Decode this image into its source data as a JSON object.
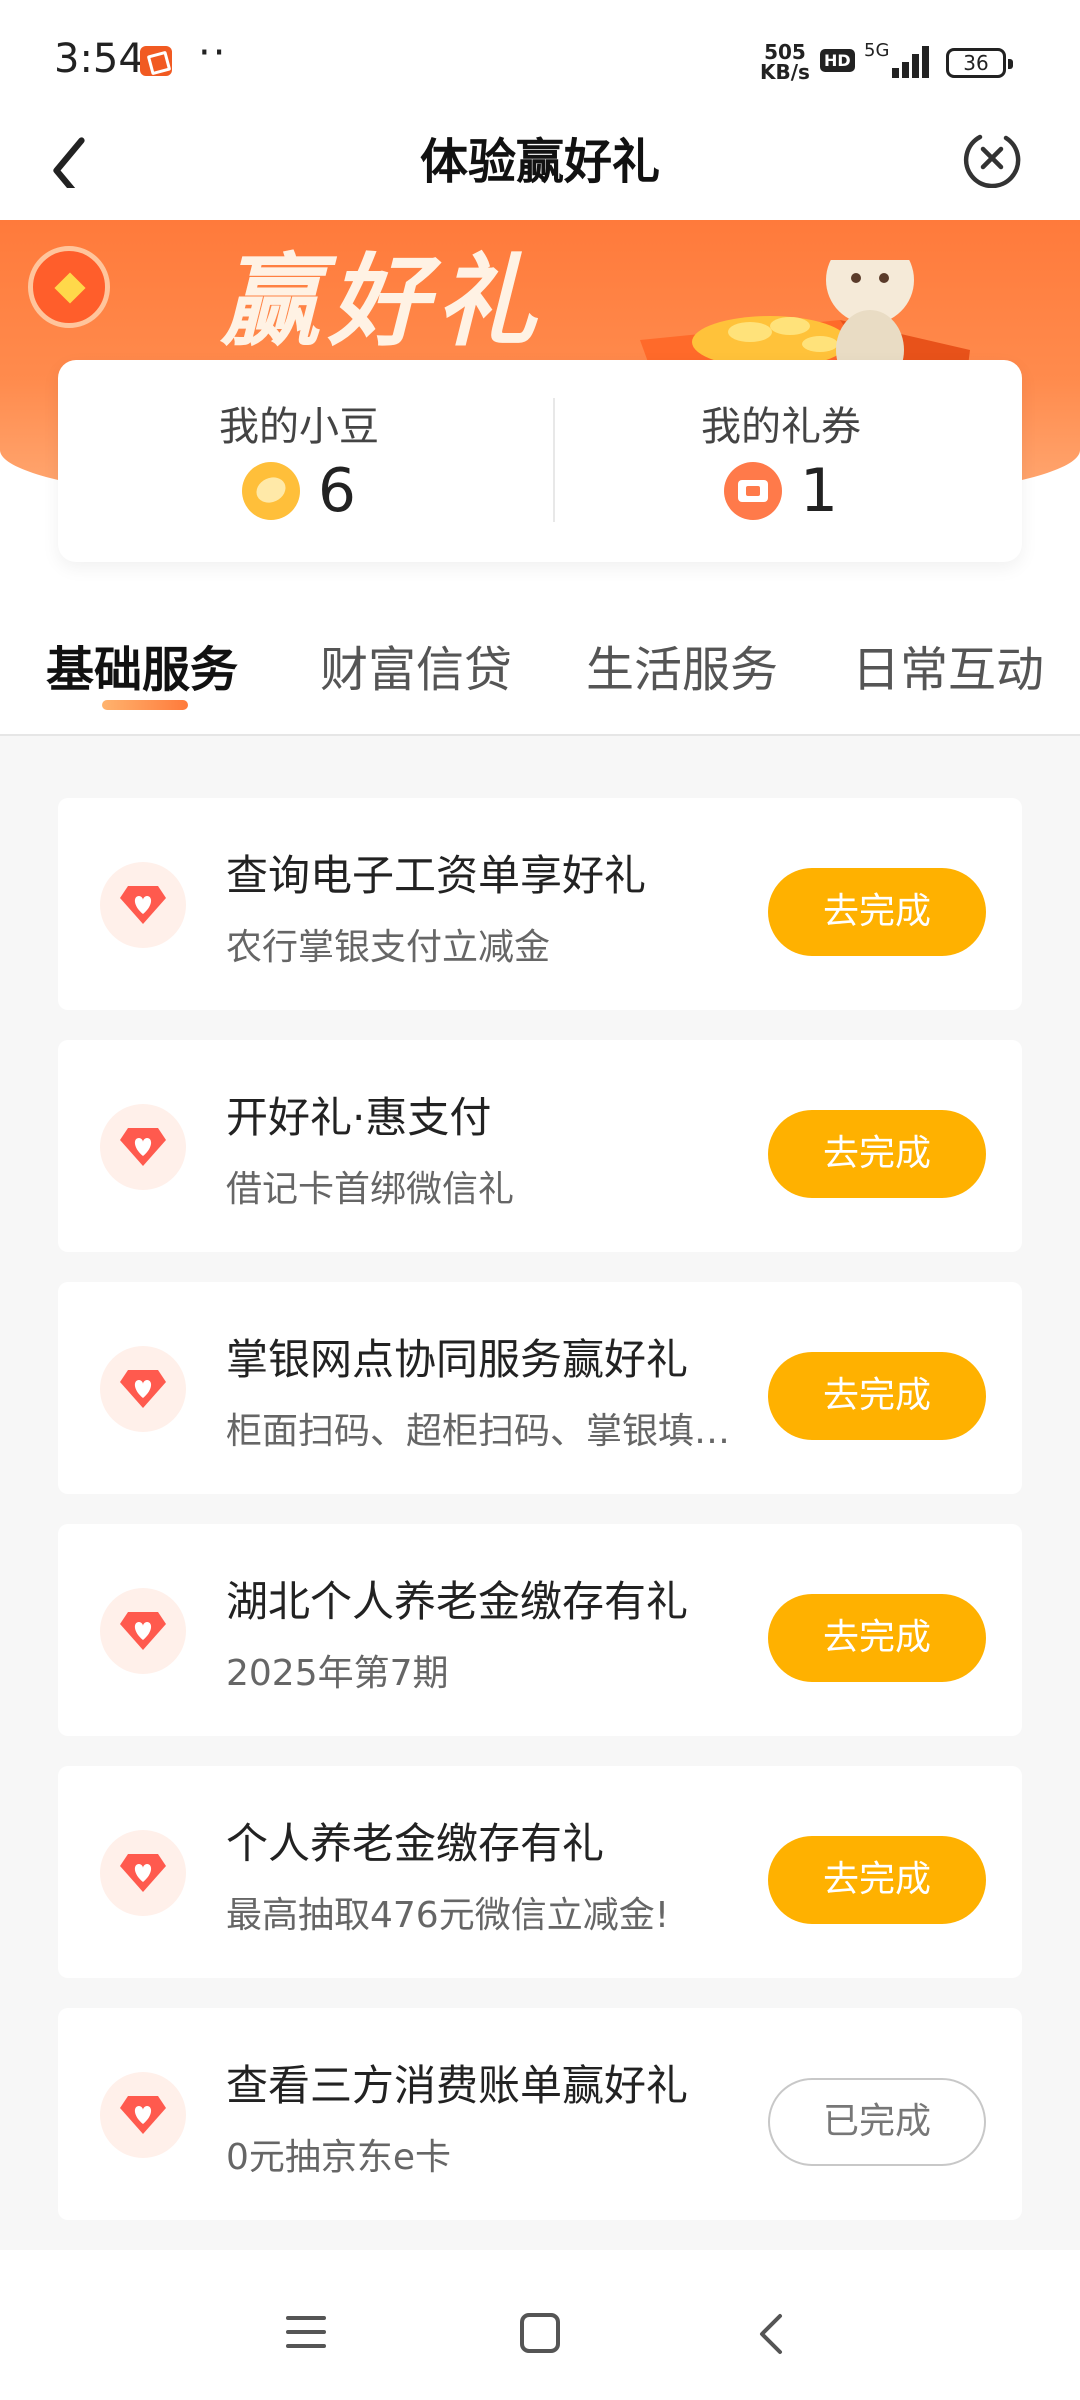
{
  "status_bar": {
    "time": "3:54",
    "dots": "··",
    "net_speed_value": "505",
    "net_speed_unit": "KB/s",
    "hd": "HD",
    "network": "5G",
    "battery": "36"
  },
  "nav": {
    "title": "体验赢好礼",
    "back_icon": "chevron-left-icon",
    "close_icon": "close-circle-icon"
  },
  "banner": {
    "title": "赢好礼"
  },
  "summary": {
    "beans_label": "我的小豆",
    "beans_value": "6",
    "coupons_label": "我的礼券",
    "coupons_value": "1"
  },
  "tabs": [
    {
      "label": "基础服务",
      "active": true
    },
    {
      "label": "财富信贷",
      "active": false
    },
    {
      "label": "生活服务",
      "active": false
    },
    {
      "label": "日常互动",
      "active": false
    }
  ],
  "tasks": [
    {
      "title": "查询电子工资单享好礼",
      "subtitle": "农行掌银支付立减金",
      "button": "去完成",
      "done": false
    },
    {
      "title": "开好礼·惠支付",
      "subtitle": "借记卡首绑微信礼",
      "button": "去完成",
      "done": false
    },
    {
      "title": "掌银网点协同服务赢好礼",
      "subtitle": "柜面扫码、超柜扫码、掌银填…",
      "button": "去完成",
      "done": false
    },
    {
      "title": "湖北个人养老金缴存有礼",
      "subtitle": "2025年第7期",
      "button": "去完成",
      "done": false
    },
    {
      "title": "个人养老金缴存有礼",
      "subtitle": "最高抽取476元微信立减金!",
      "button": "去完成",
      "done": false
    },
    {
      "title": "查看三方消费账单赢好礼",
      "subtitle": "0元抽京东e卡",
      "button": "已完成",
      "done": true
    }
  ],
  "colors": {
    "accent": "#ffb100",
    "banner": "#ff7a3b",
    "icon_red": "#ff5a4e"
  }
}
